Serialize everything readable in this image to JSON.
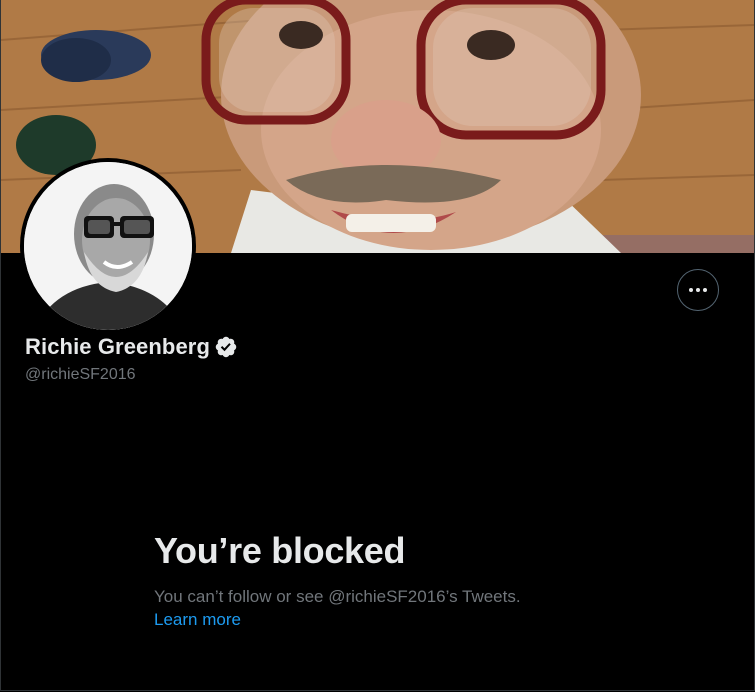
{
  "profile": {
    "display_name": "Richie Greenberg",
    "handle": "@richieSF2016",
    "verified": true
  },
  "icons": {
    "more": "more-horizontal-icon",
    "verified": "verified-badge-icon"
  },
  "blocked": {
    "title": "You’re blocked",
    "message": "You can’t follow or see @richieSF2016’s Tweets.",
    "link_label": "Learn more"
  },
  "colors": {
    "background": "#000000",
    "text_primary": "#e7e9ea",
    "text_secondary": "#71767b",
    "link": "#1d9bf0",
    "border": "#2f3336"
  }
}
